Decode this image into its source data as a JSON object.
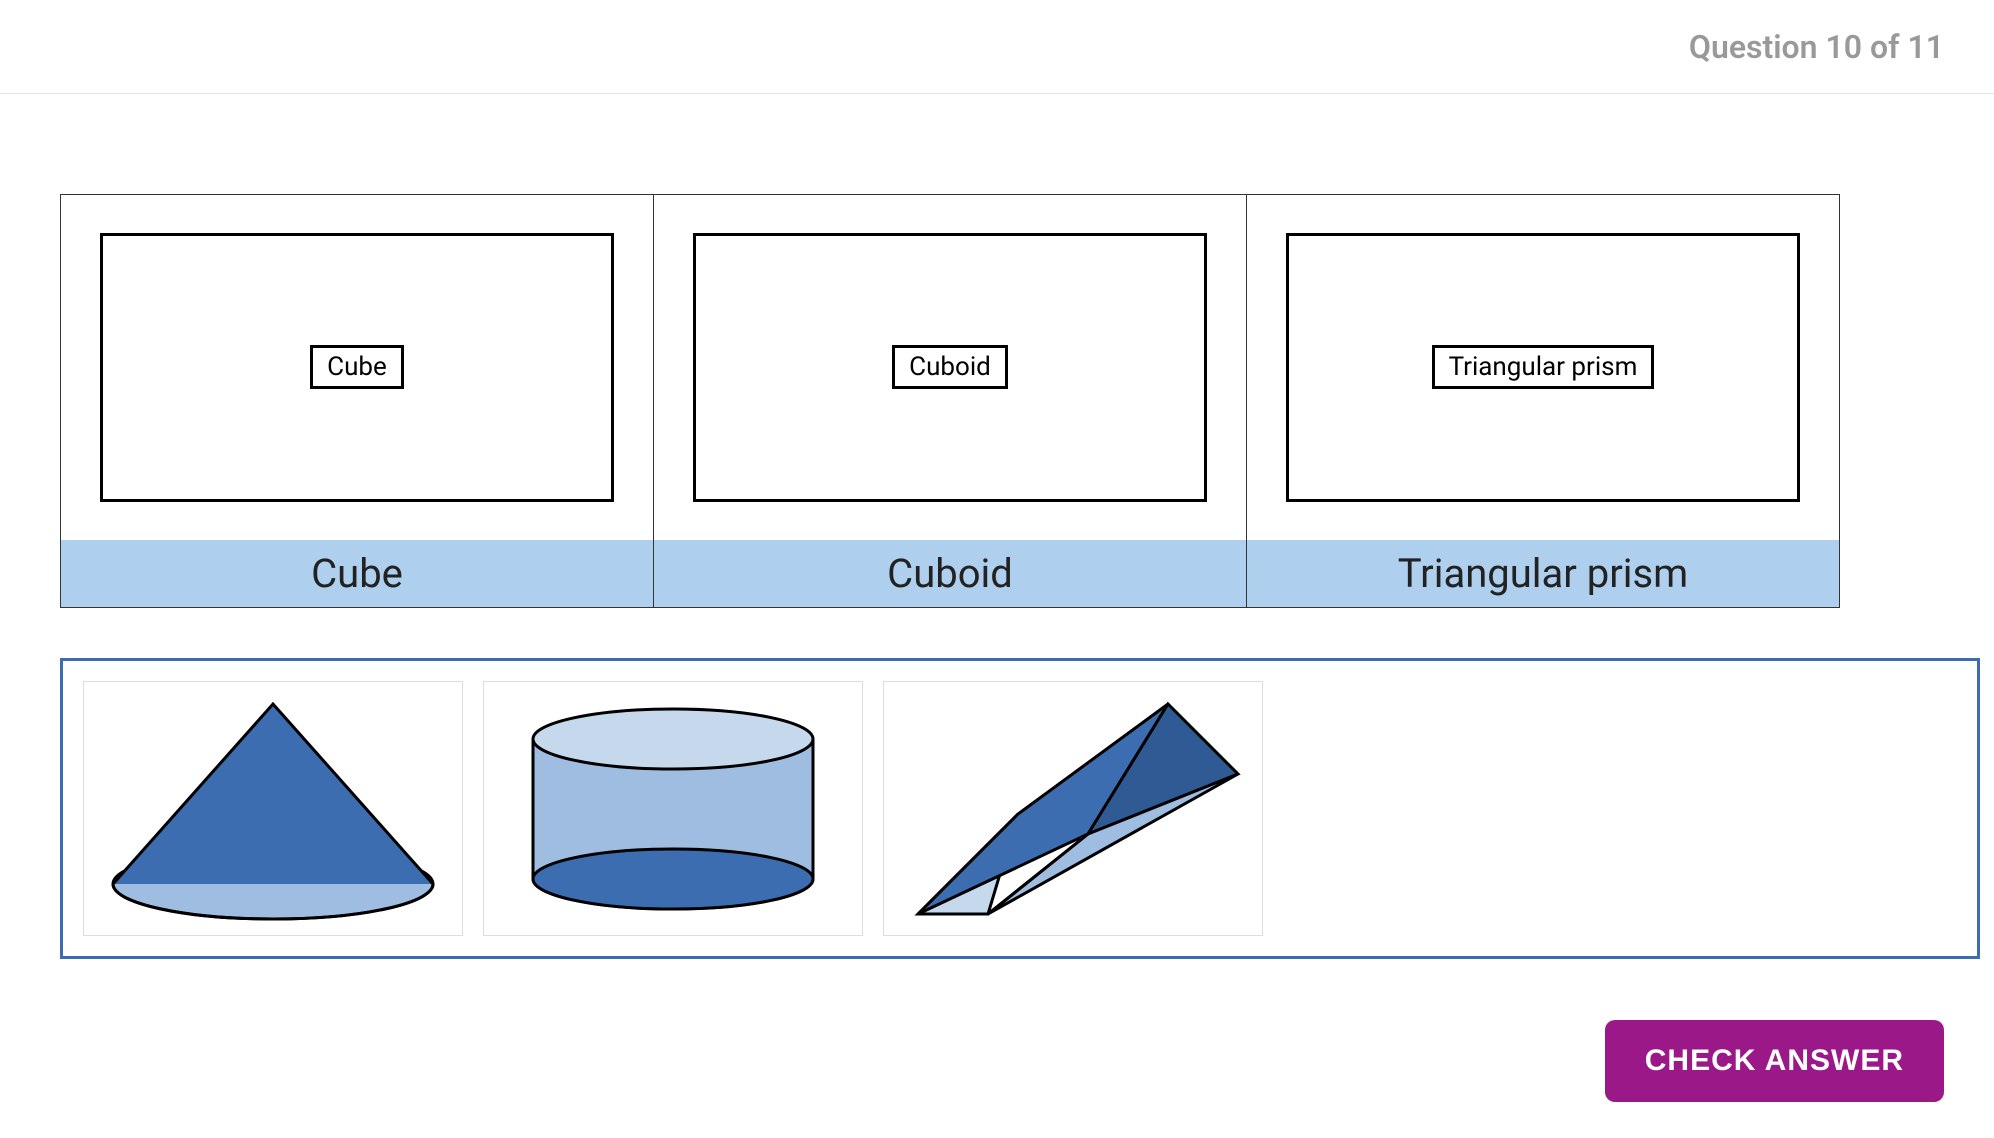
{
  "header": {
    "question_counter": "Question 10 of 11"
  },
  "columns": [
    {
      "chip": "Cube",
      "label": "Cube"
    },
    {
      "chip": "Cuboid",
      "label": "Cuboid"
    },
    {
      "chip": "Triangular prism",
      "label": "Triangular prism"
    }
  ],
  "shapes": [
    {
      "name": "cone"
    },
    {
      "name": "cylinder"
    },
    {
      "name": "triangular-prism"
    }
  ],
  "buttons": {
    "check_answer": "CHECK ANSWER"
  },
  "colors": {
    "header_blue": "#aecfee",
    "drop_border": "#3b6db0",
    "shape_fill_dark": "#3b6db0",
    "shape_fill_light": "#9ebde0",
    "button_purple": "#9b1889"
  }
}
